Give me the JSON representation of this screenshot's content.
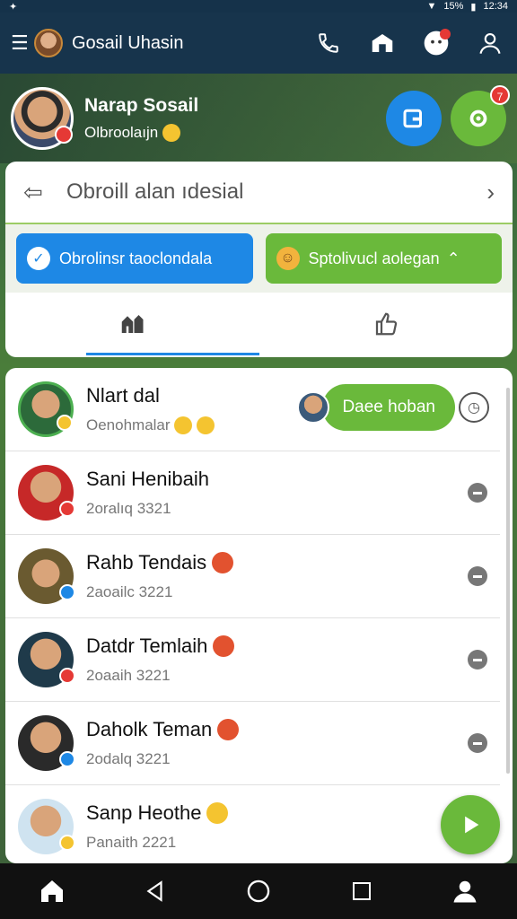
{
  "status_bar": {
    "battery": "15%",
    "time": "12:34"
  },
  "app_bar": {
    "title": "Gosail Uhasin"
  },
  "profile": {
    "name": "Narap Sosail",
    "subtitle": "Olbroolaıjn"
  },
  "search": {
    "placeholder": "Obroill alan ıdesial"
  },
  "chips": [
    {
      "label": "Obrolinsr taoclondala"
    },
    {
      "label": "Sptolivucl aolegan"
    }
  ],
  "notifications": {
    "profile_badge": "7"
  },
  "contacts": [
    {
      "name": "Nlart dal",
      "subtitle": "Oenohmalar"
    },
    {
      "name": "Sani Henibaih",
      "subtitle": "2oralıq 3321"
    },
    {
      "name": "Rahb Tendais",
      "subtitle": "2aoailc 3221"
    },
    {
      "name": "Datdr Temlaih",
      "subtitle": "2oaaih 3221"
    },
    {
      "name": "Daholk Teman",
      "subtitle": "2odalq 3221"
    },
    {
      "name": "Sanp Heothe",
      "subtitle": "Panaith 2221"
    }
  ],
  "action_pill": {
    "label": "Daee hoban"
  },
  "colors": {
    "accent_blue": "#1e88e5",
    "accent_green": "#6ab93b",
    "app_bar": "#17344c"
  }
}
